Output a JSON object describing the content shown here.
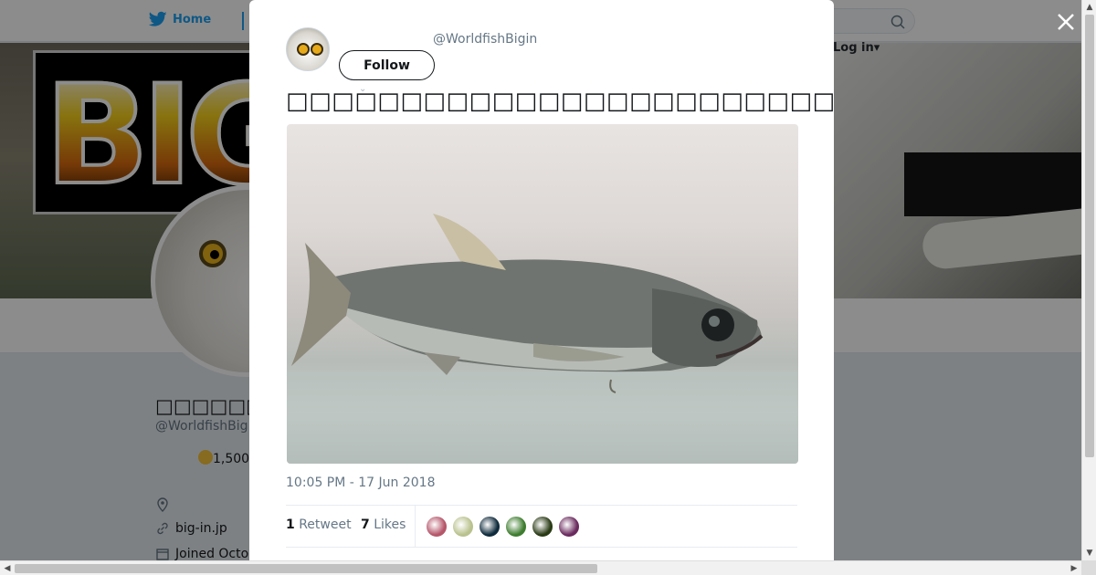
{
  "nav": {
    "home_label": "Home",
    "login_label": "Log in",
    "search_placeholder": ""
  },
  "banner": {
    "logo_text": "BIG"
  },
  "profile": {
    "name": "□□□□□□□□□□",
    "handle": "@WorldfishBig",
    "count_label": "1,500",
    "website": "big-in.jp",
    "joined": "Joined Octo"
  },
  "tweet": {
    "handle": "@WorldfishBigin",
    "follow_label": "Follow",
    "text": "□□□□□□□□□□□□□□□□□□□□□□□□□□□□□□□□□□□□□□□□□□□□□□□□□□□□□ □□□□□□□",
    "timestamp": "10:05 PM - 17 Jun 2018",
    "retweet_count": "1",
    "retweet_label": "Retweet",
    "like_count": "7",
    "like_label": "Likes",
    "likers": [
      {
        "name": "liker-1",
        "color": "#b5566a"
      },
      {
        "name": "liker-2",
        "color": "#b9c28e"
      },
      {
        "name": "liker-3",
        "color": "#0f2b3c"
      },
      {
        "name": "liker-4",
        "color": "#3e7d2f"
      },
      {
        "name": "liker-5",
        "color": "#2a3a15"
      },
      {
        "name": "liker-6",
        "color": "#6a2a5e"
      }
    ]
  },
  "colors": {
    "accent": "#1da1f2",
    "text_primary": "#14171a",
    "text_secondary": "#657786"
  }
}
